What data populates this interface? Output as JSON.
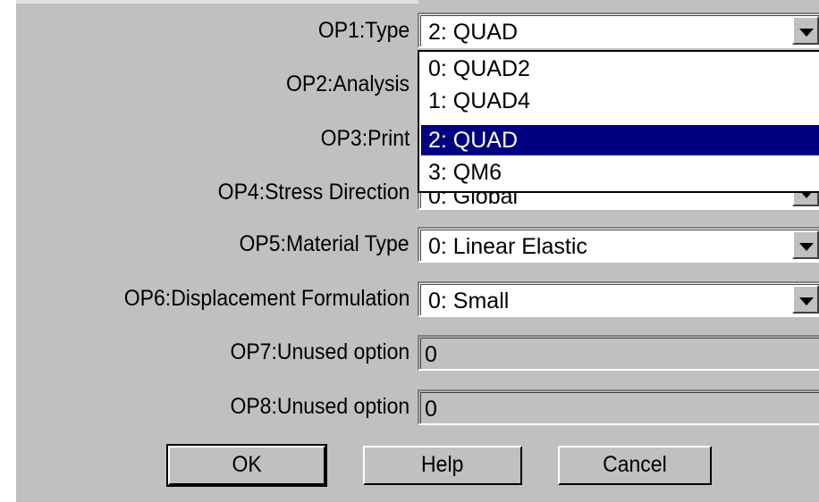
{
  "form": {
    "rows": [
      {
        "label": "OP1:Type",
        "value": "2: QUAD"
      },
      {
        "label": "OP2:Analysis",
        "value": ""
      },
      {
        "label": "OP3:Print",
        "value": ""
      },
      {
        "label": "OP4:Stress Direction",
        "value": "0: Global"
      },
      {
        "label": "OP5:Material Type",
        "value": "0:   Linear Elastic"
      },
      {
        "label": "OP6:Displacement Formulation",
        "value": "0: Small"
      },
      {
        "label": "OP7:Unused option",
        "value": "0"
      },
      {
        "label": "OP8:Unused option",
        "value": "0"
      }
    ]
  },
  "dropdown": {
    "options": [
      "0: QUAD2",
      "1: QUAD4",
      "2: QUAD",
      "3: QM6"
    ],
    "selected": "2: QUAD"
  },
  "buttons": {
    "ok": "OK",
    "help": "Help",
    "cancel": "Cancel"
  },
  "icons": {
    "dropdown_arrow": "triangle-down-icon"
  },
  "colors": {
    "dialog_bg": "#c0c0c0",
    "selection_bg": "#000080",
    "selection_fg": "#ffffff"
  }
}
